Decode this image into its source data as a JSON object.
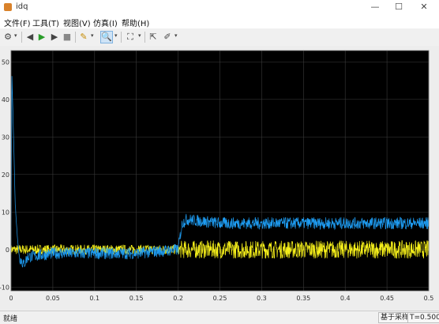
{
  "window": {
    "title": "idq",
    "minimize": "—",
    "maximize": "☐",
    "close": "✕"
  },
  "menu": [
    "文件(F)",
    "工具(T)",
    "视图(V)",
    "仿真(I)",
    "帮助(H)"
  ],
  "toolbar_icons": [
    "settings-icon",
    "step-back-icon",
    "run-icon",
    "step-forward-icon",
    "stop-icon",
    "highlight-icon",
    "zoom-icon",
    "fit-icon",
    "cursor-icon",
    "style-icon"
  ],
  "status": {
    "left": "就绪",
    "sample": "基于采样",
    "time": "T=0.500"
  },
  "colors": {
    "plot_bg": "#000000",
    "grid": "#3a3a3a",
    "axis_text": "#d8d8d8",
    "series_blue": "#1e9bf0",
    "series_yellow": "#f5ef1a"
  },
  "chart_data": {
    "type": "line",
    "title": "",
    "xlabel": "",
    "ylabel": "",
    "xlim": [
      0,
      0.5
    ],
    "ylim": [
      -11,
      53
    ],
    "xticks": [
      0,
      0.05,
      0.1,
      0.15,
      0.2,
      0.25,
      0.3,
      0.35,
      0.4,
      0.45,
      0.5
    ],
    "xtick_labels": [
      "0",
      "0.05",
      "0.1",
      "0.15",
      "0.2",
      "0.25",
      "0.3",
      "0.35",
      "0.4",
      "0.45",
      "0.5"
    ],
    "yticks": [
      -10,
      0,
      10,
      20,
      30,
      40,
      50
    ],
    "ytick_labels": [
      "-10",
      "0",
      "10",
      "20",
      "30",
      "40",
      "50"
    ],
    "grid": true,
    "series": [
      {
        "color": "#1e9bf0",
        "x": [
          0,
          0.001,
          0.003,
          0.005,
          0.008,
          0.01,
          0.015,
          0.02,
          0.05,
          0.1,
          0.15,
          0.2,
          0.202,
          0.205,
          0.21,
          0.25,
          0.3,
          0.35,
          0.4,
          0.45,
          0.5
        ],
        "y": [
          0,
          47,
          30,
          12,
          2,
          -2,
          -4,
          -2,
          -1,
          -1,
          -1,
          0,
          3,
          7,
          8,
          7,
          7,
          7,
          7,
          7,
          7
        ],
        "noise": 1.6
      },
      {
        "color": "#f5ef1a",
        "x": [
          0,
          0.02,
          0.05,
          0.1,
          0.15,
          0.2,
          0.205,
          0.25,
          0.3,
          0.35,
          0.4,
          0.45,
          0.5
        ],
        "y": [
          0,
          0,
          0,
          0,
          0,
          0,
          0,
          0,
          0,
          0,
          0,
          0,
          0
        ],
        "noise_before": 1.3,
        "noise_after": 2.4,
        "noise_change_x": 0.202
      }
    ]
  }
}
